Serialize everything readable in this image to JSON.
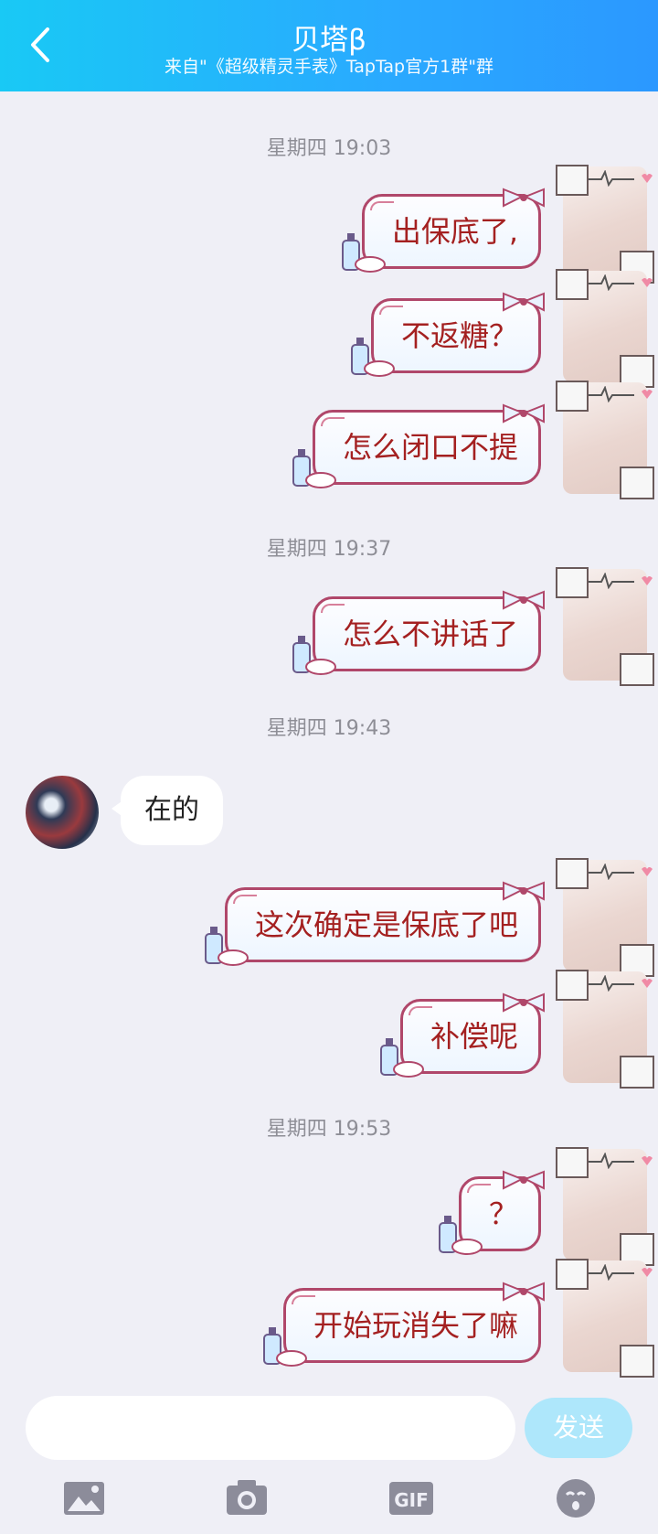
{
  "header": {
    "title": "贝塔β",
    "subtitle": "来自\"《超级精灵手表》TapTap官方1群\"群"
  },
  "timestamps": [
    "星期四 19:03",
    "星期四 19:37",
    "星期四 19:43",
    "星期四 19:53"
  ],
  "messages": [
    {
      "text": "出保底了,"
    },
    {
      "text": "不返糖？"
    },
    {
      "text": "怎么闭口不提"
    },
    {
      "text": "怎么不讲话了"
    },
    {
      "text": "在的"
    },
    {
      "text": "这次确定是保底了吧"
    },
    {
      "text": "补偿呢"
    },
    {
      "text": "？"
    },
    {
      "text": "开始玩消失了嘛"
    }
  ],
  "composer": {
    "placeholder": "",
    "send_label": "发送"
  },
  "toolbar": {
    "gif_label": "GIF"
  },
  "colors": {
    "header_start": "#19c9f5",
    "header_end": "#2b98ff",
    "bubble_border": "#b0476a",
    "bubble_text": "#a42020",
    "send_disabled": "#aee7fb"
  },
  "icons": [
    "back-icon",
    "image-icon",
    "camera-icon",
    "gif-icon",
    "emoji-icon"
  ]
}
